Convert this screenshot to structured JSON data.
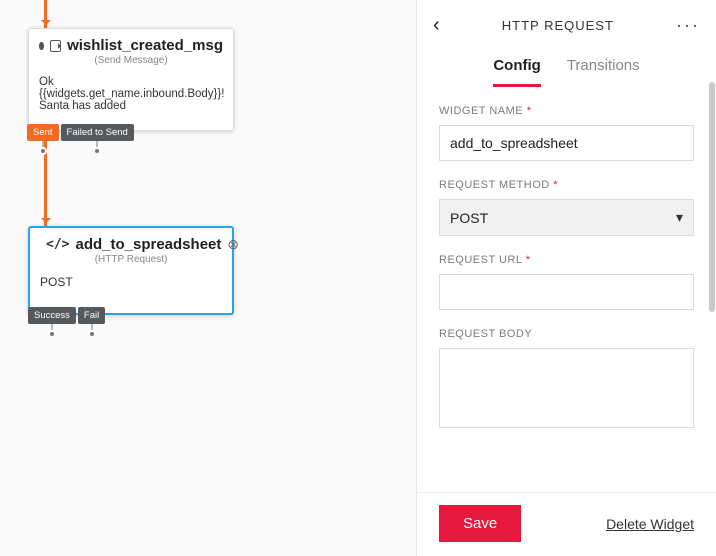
{
  "canvas": {
    "widgets": [
      {
        "title": "wishlist_created_msg",
        "subtitle": "(Send Message)",
        "body": "Ok {{widgets.get_name.inbound.Body}}! Santa has added",
        "pills": [
          "Sent",
          "Failed to Send"
        ]
      },
      {
        "title": "add_to_spreadsheet",
        "subtitle": "(HTTP Request)",
        "body": "POST",
        "pills": [
          "Success",
          "Fail"
        ]
      }
    ]
  },
  "panel": {
    "title": "HTTP REQUEST",
    "tabs": {
      "config": "Config",
      "transitions": "Transitions"
    },
    "fields": {
      "widget_name": {
        "label": "WIDGET NAME",
        "value": "add_to_spreadsheet"
      },
      "request_method": {
        "label": "REQUEST METHOD",
        "value": "POST"
      },
      "request_url": {
        "label": "REQUEST URL",
        "value": ""
      },
      "request_body": {
        "label": "REQUEST BODY",
        "value": ""
      }
    },
    "footer": {
      "save": "Save",
      "delete": "Delete Widget"
    }
  }
}
